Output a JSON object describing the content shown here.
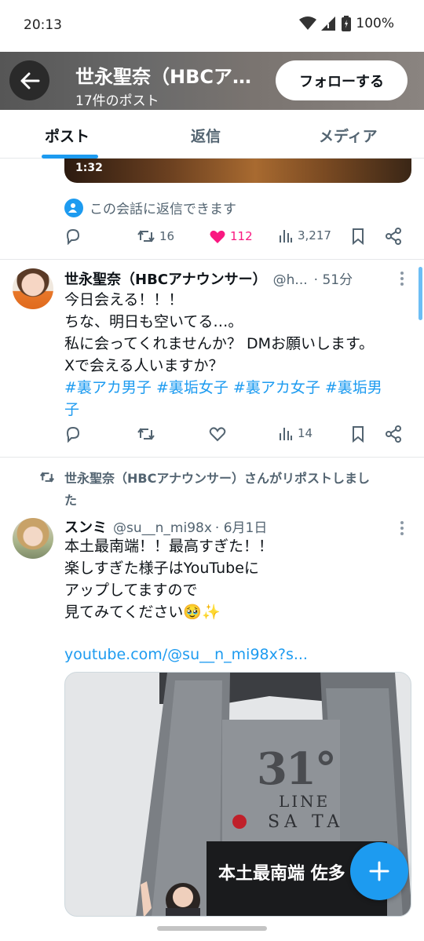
{
  "status_bar": {
    "time": "20:13",
    "battery": "100%"
  },
  "header": {
    "title": "世永聖奈（HBCア…",
    "subtitle": "17件のポスト",
    "follow_label": "フォローする"
  },
  "tabs": [
    {
      "label": "ポスト",
      "active": true
    },
    {
      "label": "返信",
      "active": false
    },
    {
      "label": "メディア",
      "active": false
    }
  ],
  "prev_post": {
    "video_duration": "1:32",
    "reply_note": "この会話に返信できます",
    "actions": {
      "reposts": "16",
      "likes": "112",
      "views": "3,217",
      "liked": true
    }
  },
  "post1": {
    "name": "世永聖奈（HBCアナウンサー）",
    "handle": "@h...",
    "time": "· 51分",
    "lines": [
      "今日会える！！！",
      "ちな、明日も空いてる…。",
      "私に会ってくれませんか？ DMお願いします。",
      "Xで会える人いますか？"
    ],
    "hashtags_line1": "#裏アカ男子 #裏垢女子 #裏アカ女子 #裏垢男",
    "hashtags_line2": "子",
    "actions": {
      "views": "14"
    }
  },
  "repost_notice": {
    "line1": "世永聖奈（HBCアナウンサー）さんがリポストしまし",
    "line2": "た"
  },
  "post2": {
    "name": "スンミ",
    "handle": "@su__n_mi98x",
    "time": "· 6月1日",
    "lines": [
      "本土最南端！！最高すぎた！！",
      "楽しすぎた様子はYouTubeに",
      "アップしてますので",
      "見てみてください🥹✨"
    ],
    "link": "youtube.com/@su__n_mi98x?s...",
    "image_signs": {
      "number": "31°",
      "line": "LINE",
      "place": "SA TA",
      "banner": "本土最南端 佐多"
    }
  },
  "colors": {
    "accent": "#1d9bf0",
    "like": "#f91880",
    "secondary_text": "#536471"
  }
}
